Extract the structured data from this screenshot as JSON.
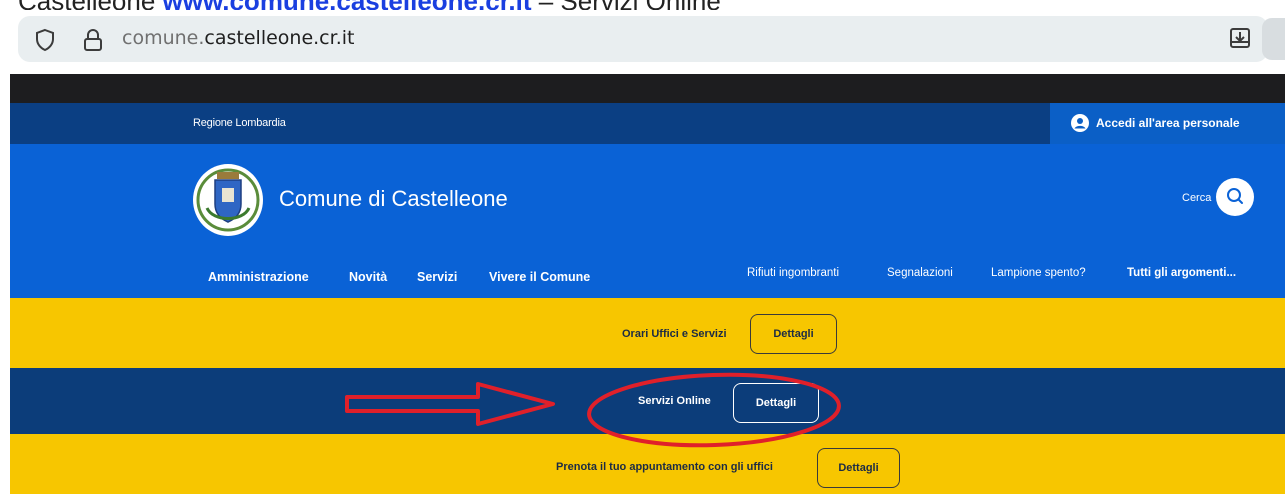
{
  "caption": {
    "prefix": "Castelleone ",
    "link": "www.comune.castelleone.cr.it",
    "suffix": " – Servizi Online"
  },
  "browser": {
    "url_prefix": "comune.",
    "url_domain": "castelleone.cr.it",
    "icons": [
      "shield-icon",
      "lock-icon",
      "download-icon"
    ]
  },
  "site": {
    "region_label": "Regione Lombardia",
    "login_label": "Accedi all'area personale",
    "name": "Comune di Castelleone",
    "search_label": "Cerca",
    "nav_main": [
      "Amministrazione",
      "Novità",
      "Servizi",
      "Vivere il Comune"
    ],
    "nav_secondary": [
      "Rifiuti ingombranti",
      "Segnalazioni",
      "Lampione spento?",
      "Tutti gli argomenti..."
    ]
  },
  "bands": [
    {
      "title": "Orari Uffici e Servizi",
      "button": "Dettagli"
    },
    {
      "title": "Servizi Online",
      "button": "Dettagli"
    },
    {
      "title": "Prenota il tuo appuntamento con gli uffici",
      "button": "Dettagli"
    }
  ],
  "colors": {
    "header_blue": "#0a62d6",
    "region_navy": "#0b3f83",
    "band_yellow": "#f7c600",
    "band_navy": "#0c3d7a",
    "annotation_red": "#e0202a"
  }
}
